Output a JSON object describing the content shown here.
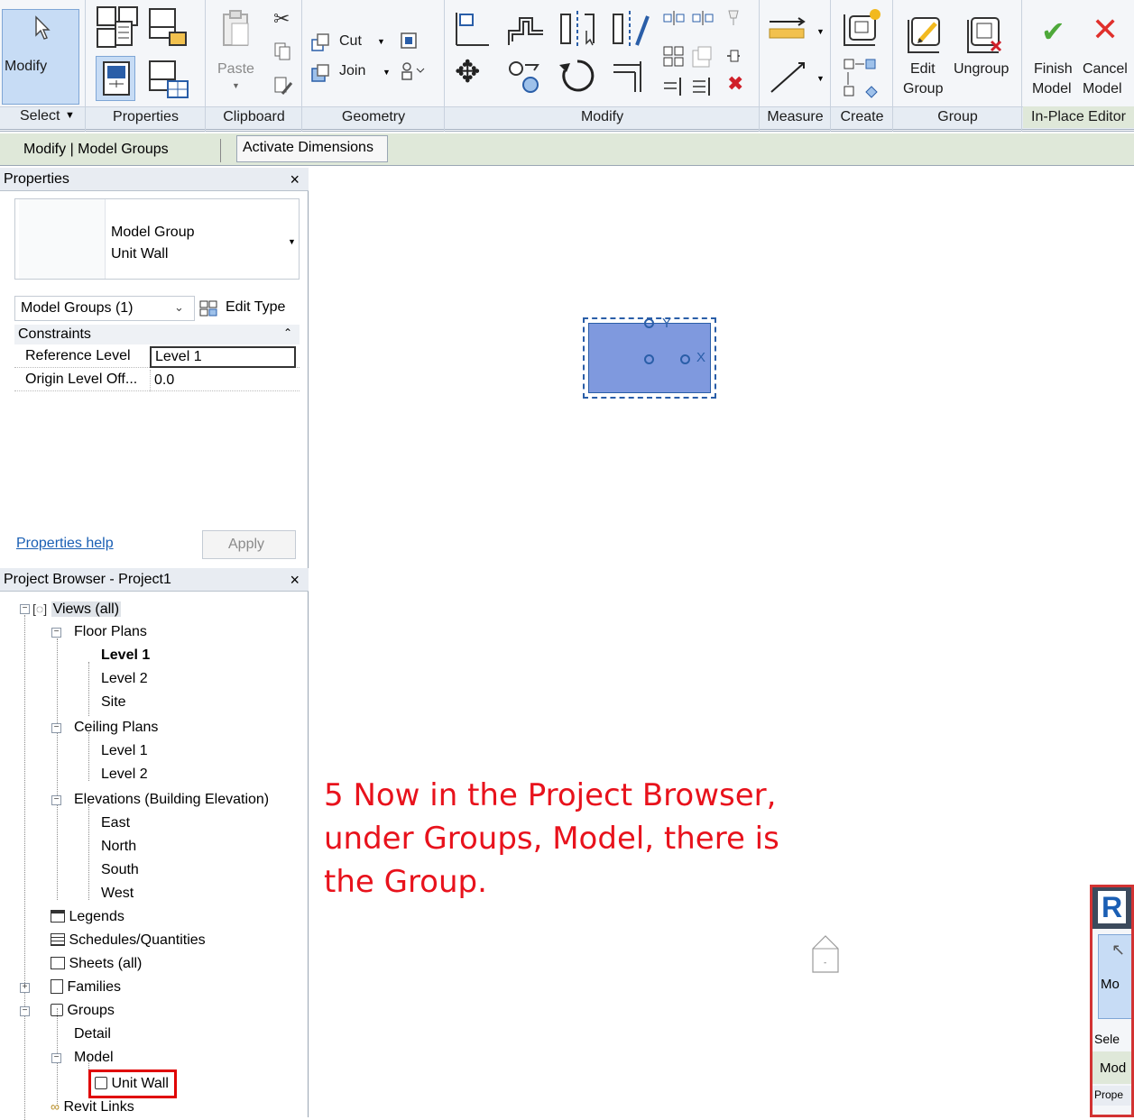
{
  "ribbon": {
    "modify_label": "Modify",
    "select_label": "Select",
    "properties_panel": "Properties",
    "clipboard_panel": "Clipboard",
    "paste_label": "Paste",
    "geometry_panel": "Geometry",
    "cut_label": "Cut",
    "join_label": "Join",
    "modify_panel": "Modify",
    "measure_panel": "Measure",
    "create_panel": "Create",
    "group_panel": "Group",
    "edit_group_line1": "Edit",
    "edit_group_line2": "Group",
    "ungroup_label": "Ungroup",
    "inplace_panel": "In-Place Editor",
    "finish_line1": "Finish",
    "finish_line2": "Model",
    "cancel_line1": "Cancel",
    "cancel_line2": "Model"
  },
  "context_bar": {
    "title": "Modify | Model Groups",
    "activate_dimensions": "Activate Dimensions"
  },
  "properties": {
    "header": "Properties",
    "type_line1": "Model Group",
    "type_line2": "Unit Wall",
    "selector": "Model Groups (1)",
    "edit_type": "Edit Type",
    "section": "Constraints",
    "rows": [
      {
        "label": "Reference Level",
        "value": "Level 1"
      },
      {
        "label": "Origin Level Off...",
        "value": "0.0"
      }
    ],
    "help_link": "Properties help",
    "apply": "Apply"
  },
  "browser": {
    "header": "Project Browser - Project1",
    "views_all": "Views (all)",
    "floor_plans": "Floor Plans",
    "fp_level1": "Level 1",
    "fp_level2": "Level 2",
    "fp_site": "Site",
    "ceiling_plans": "Ceiling Plans",
    "cp_level1": "Level 1",
    "cp_level2": "Level 2",
    "elevations": "Elevations (Building Elevation)",
    "el_east": "East",
    "el_north": "North",
    "el_south": "South",
    "el_west": "West",
    "legends": "Legends",
    "schedules": "Schedules/Quantities",
    "sheets": "Sheets (all)",
    "families": "Families",
    "groups": "Groups",
    "detail": "Detail",
    "model": "Model",
    "unit_wall": "Unit Wall",
    "revit_links": "Revit Links"
  },
  "canvas": {
    "annotation_line1": "5 Now in the Project Browser,",
    "annotation_line2": "under Groups, Model, there is",
    "annotation_line3": "the Group.",
    "axis_y": "Y",
    "axis_x": "X",
    "annotation_color": "#e8121c",
    "group_fill": "#7f99de"
  },
  "inset": {
    "modify_partial": "Mo",
    "select_partial": "Sele",
    "mod_partial": "Mod",
    "props_partial": "Prope"
  }
}
